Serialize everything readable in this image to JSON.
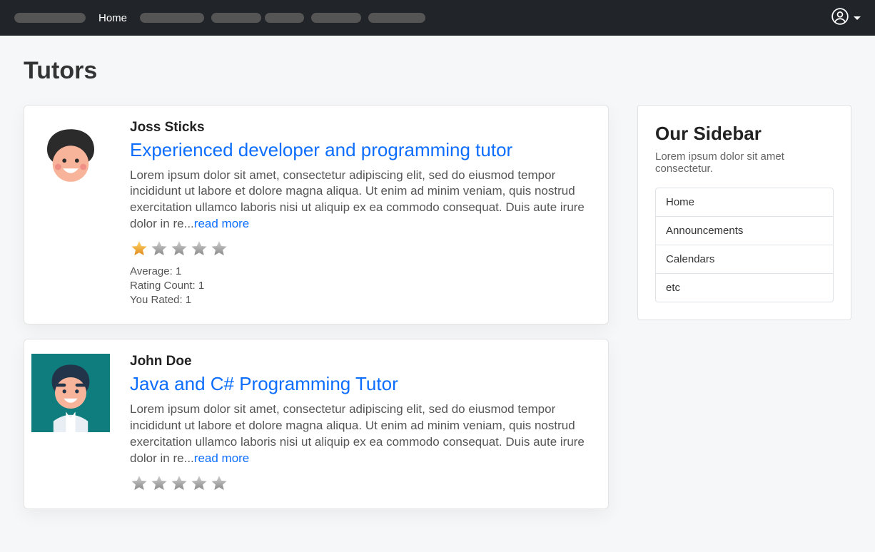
{
  "nav": {
    "home": "Home"
  },
  "page": {
    "title": "Tutors"
  },
  "tutors": [
    {
      "name": "Joss Sticks",
      "title": "Experienced developer and programming tutor",
      "desc": "Lorem ipsum dolor sit amet, consectetur adipiscing elit, sed do eiusmod tempor incididunt ut labore et dolore magna aliqua. Ut enim ad minim veniam, quis nostrud exercitation ullamco laboris nisi ut aliquip ex ea commodo consequat. Duis aute irure dolor in re",
      "ellipsis": "...",
      "read_more": "read more",
      "rating_filled": 1,
      "average_label": "Average:",
      "average_value": "1",
      "count_label": "Rating Count:",
      "count_value": "1",
      "yourated_label": "You Rated:",
      "yourated_value": "1"
    },
    {
      "name": "John Doe",
      "title": "Java and C# Programming Tutor",
      "desc": "Lorem ipsum dolor sit amet, consectetur adipiscing elit, sed do eiusmod tempor incididunt ut labore et dolore magna aliqua. Ut enim ad minim veniam, quis nostrud exercitation ullamco laboris nisi ut aliquip ex ea commodo consequat. Duis aute irure dolor in re",
      "ellipsis": "...",
      "read_more": "read more",
      "rating_filled": 0
    }
  ],
  "sidebar": {
    "title": "Our Sidebar",
    "desc": "Lorem ipsum dolor sit amet consectetur.",
    "items": [
      "Home",
      "Announcements",
      "Calendars",
      "etc"
    ]
  }
}
